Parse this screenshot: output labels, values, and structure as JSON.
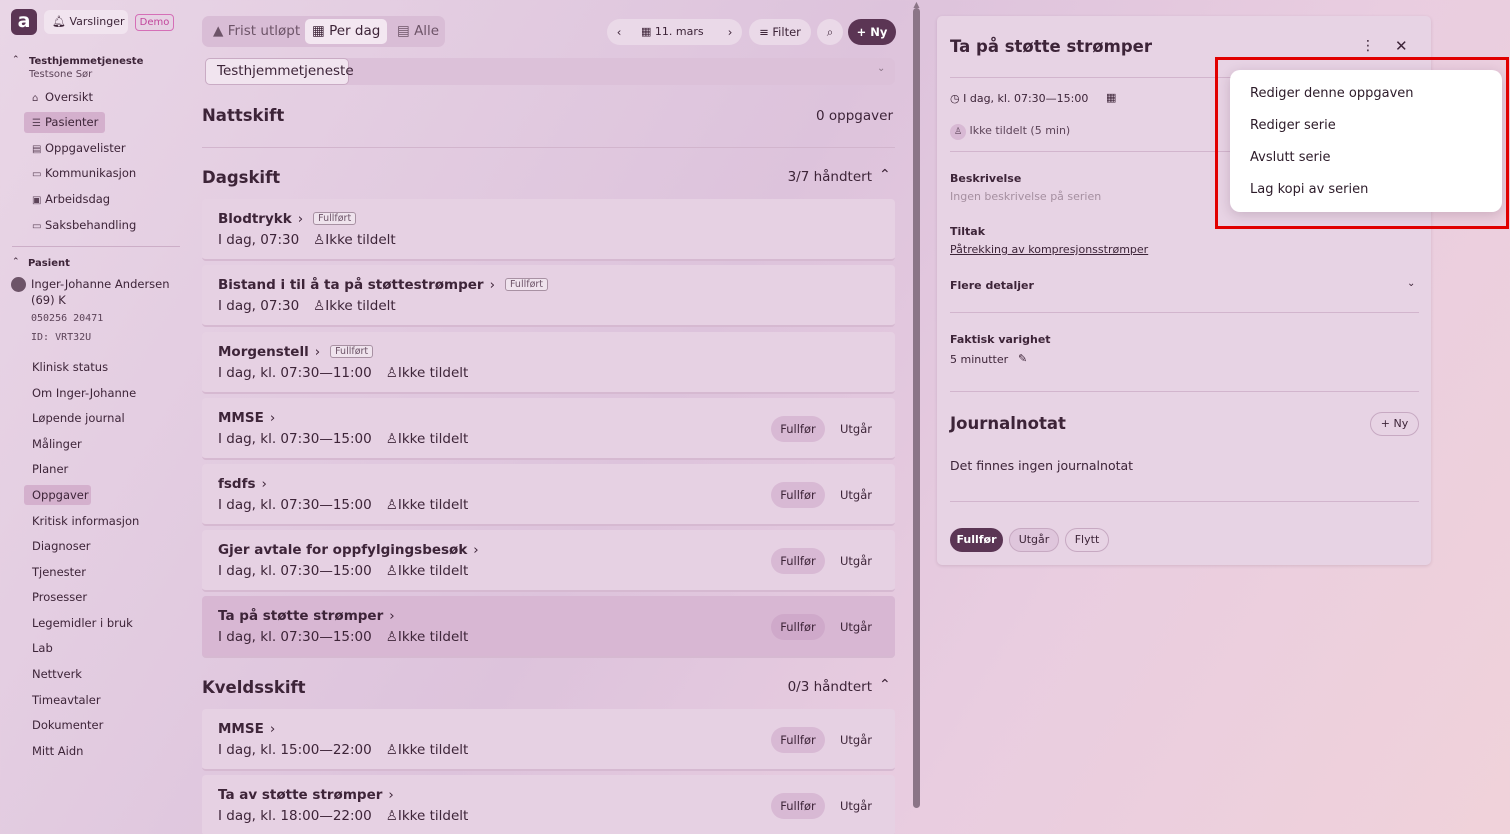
{
  "sidebar": {
    "logo": "a",
    "notifications_label": "Varslinger",
    "demo_badge": "Demo",
    "org": {
      "name": "Testhjemmetjeneste",
      "zone": "Testsone Sør"
    },
    "nav": [
      {
        "label": "Oversikt",
        "icon": "home-icon"
      },
      {
        "label": "Pasienter",
        "icon": "patients-icon"
      },
      {
        "label": "Oppgavelister",
        "icon": "clipboard-icon"
      },
      {
        "label": "Kommunikasjon",
        "icon": "message-icon"
      },
      {
        "label": "Arbeidsdag",
        "icon": "briefcase-icon"
      },
      {
        "label": "Saksbehandling",
        "icon": "folder-icon"
      }
    ],
    "patient_section": "Pasient",
    "patient": {
      "name": "Inger-Johanne Andersen",
      "age": "(69) K",
      "ssn": "050256 20471",
      "id": "ID: VRT32U"
    },
    "patient_nav": [
      "Klinisk status",
      "Om Inger-Johanne",
      "Løpende journal",
      "Målinger",
      "Planer",
      "Oppgaver",
      "Kritisk informasjon",
      "Diagnoser",
      "Tjenester",
      "Prosesser",
      "Legemidler i bruk",
      "Lab",
      "Nettverk",
      "Timeavtaler",
      "Dokumenter",
      "Mitt Aidn"
    ]
  },
  "toolbar": {
    "tabs": [
      "Frist utløpt",
      "Per dag",
      "Alle"
    ],
    "date": "11. mars",
    "filter": "Filter",
    "new": "Ny",
    "dropdown_value": "Testhjemmetjeneste"
  },
  "shifts": {
    "night": {
      "title": "Nattskift",
      "count": "0 oppgaver"
    },
    "day": {
      "title": "Dagskift",
      "count": "3/7 håndtert"
    },
    "evening": {
      "title": "Kveldsskift",
      "count": "0/3 håndtert"
    }
  },
  "labels": {
    "complete": "Fullfør",
    "expired": "Utgår",
    "done_badge": "Fullført"
  },
  "tasks": [
    {
      "title": "Blodtrykk",
      "time": "I dag, 07:30",
      "assignee": "Ikke tildelt",
      "done": true
    },
    {
      "title": "Bistand i til å ta på støttestrømper",
      "time": "I dag, 07:30",
      "assignee": "Ikke tildelt",
      "done": true
    },
    {
      "title": "Morgenstell",
      "time": "I dag, kl. 07:30—11:00",
      "assignee": "Ikke tildelt",
      "done": true
    },
    {
      "title": "MMSE",
      "time": "I dag, kl. 07:30—15:00",
      "assignee": "Ikke tildelt",
      "done": false
    },
    {
      "title": "fsdfs",
      "time": "I dag, kl. 07:30—15:00",
      "assignee": "Ikke tildelt",
      "done": false
    },
    {
      "title": "Gjer avtale for oppfylgingsbesøk",
      "time": "I dag, kl. 07:30—15:00",
      "assignee": "Ikke tildelt",
      "done": false
    },
    {
      "title": "Ta på støtte strømper",
      "time": "I dag, kl. 07:30—15:00",
      "assignee": "Ikke tildelt",
      "done": false
    },
    {
      "title": "MMSE",
      "time": "I dag, kl. 15:00—22:00",
      "assignee": "Ikke tildelt",
      "done": false
    },
    {
      "title": "Ta av støtte strømper",
      "time": "I dag, kl. 18:00—22:00",
      "assignee": "Ikke tildelt",
      "done": false
    }
  ],
  "detail": {
    "title": "Ta på støtte strømper",
    "time": "I dag, kl. 07:30—15:00",
    "assignee": "Ikke tildelt",
    "duration_hint": "(5 min)",
    "description_label": "Beskrivelse",
    "description_value": "Ingen beskrivelse på serien",
    "measure_label": "Tiltak",
    "measure_value": "Påtrekking av kompresjonsstrømper",
    "more_details": "Flere detaljer",
    "actual_duration_label": "Faktisk varighet",
    "actual_duration_value": "5 minutter",
    "journal_title": "Journalnotat",
    "journal_new": "Ny",
    "journal_empty": "Det finnes ingen journalnotat",
    "actions": [
      "Fullfør",
      "Utgår",
      "Flytt"
    ]
  },
  "context_menu": [
    "Rediger denne oppgaven",
    "Rediger serie",
    "Avslutt serie",
    "Lag kopi av serien"
  ]
}
